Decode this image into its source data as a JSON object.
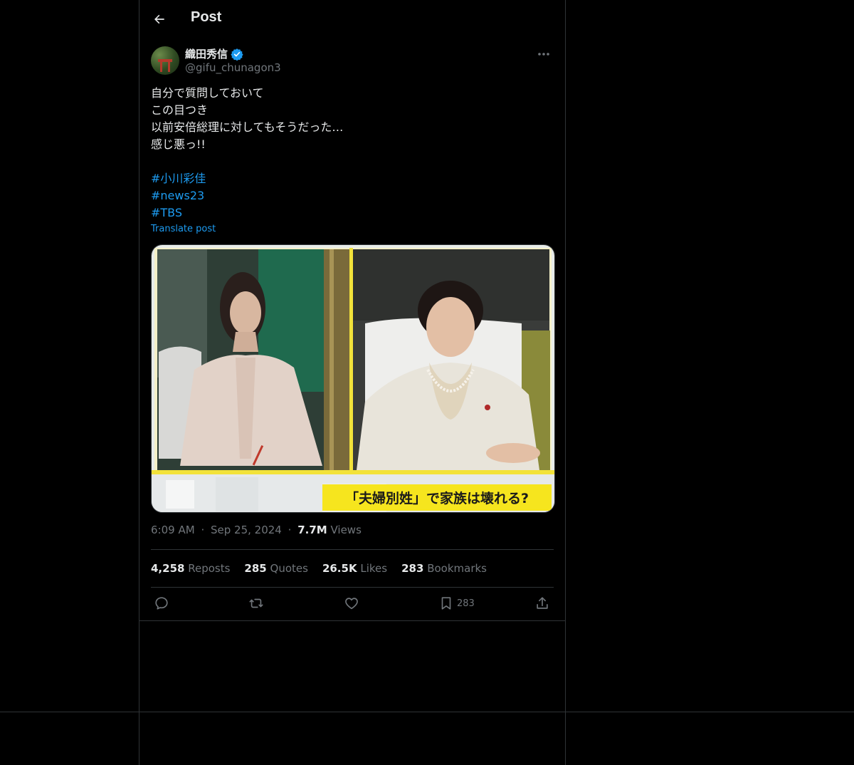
{
  "header": {
    "title": "Post"
  },
  "author": {
    "display_name": "織田秀信",
    "handle": "@gifu_chunagon3",
    "verified": true
  },
  "tweet": {
    "lines": [
      "自分で質問しておいて",
      "この目つき",
      "以前安倍総理に対してもそうだった…",
      "感じ悪っ!!"
    ],
    "hashtags": [
      "#小川彩佳",
      "#news23",
      "#TBS"
    ],
    "translate_label": "Translate post"
  },
  "media": {
    "caption": "「夫婦別姓」で家族は壊れる?"
  },
  "meta": {
    "time": "6:09 AM",
    "date": "Sep 25, 2024",
    "sep": "·",
    "views_count": "7.7M",
    "views_label": "Views"
  },
  "stats": {
    "reposts_count": "4,258",
    "reposts_label": "Reposts",
    "quotes_count": "285",
    "quotes_label": "Quotes",
    "likes_count": "26.5K",
    "likes_label": "Likes",
    "bookmarks_count": "283",
    "bookmarks_label": "Bookmarks"
  },
  "actions": {
    "bookmark_count": "283"
  },
  "colors": {
    "accent": "#1d9bf0",
    "muted": "#71767b",
    "text": "#e7e9ea",
    "border": "#2f3336"
  }
}
